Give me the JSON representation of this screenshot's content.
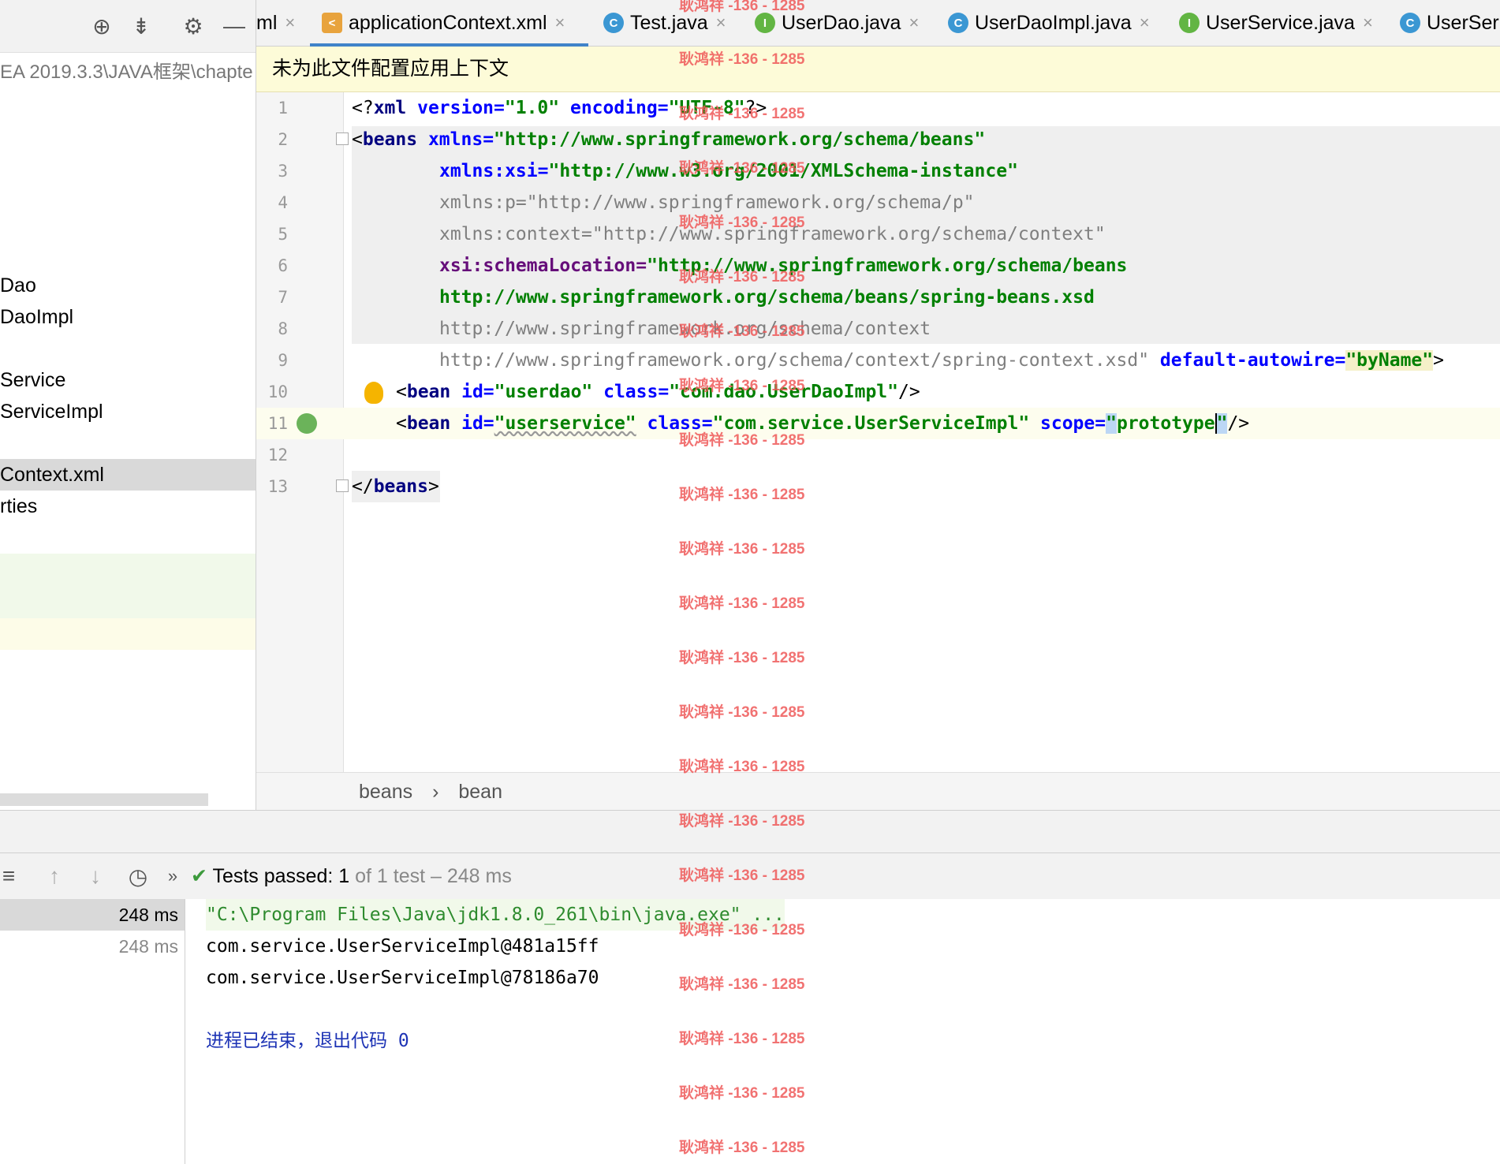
{
  "project_panel": {
    "path_text": "EA 2019.3.3\\JAVA框架\\chapte",
    "items": [
      {
        "label": "Dao"
      },
      {
        "label": "DaoImpl"
      },
      {
        "label": "Service"
      },
      {
        "label": "ServiceImpl"
      },
      {
        "label": "Context.xml"
      },
      {
        "label": "rties"
      }
    ]
  },
  "tabs": [
    {
      "label": "ml",
      "icon": "xml-file-icon"
    },
    {
      "label": "applicationContext.xml",
      "icon": "spring-xml-icon",
      "active": true
    },
    {
      "label": "Test.java",
      "icon": "class-icon",
      "icon_letter": "C"
    },
    {
      "label": "UserDao.java",
      "icon": "interface-icon",
      "icon_letter": "I"
    },
    {
      "label": "UserDaoImpl.java",
      "icon": "class-icon",
      "icon_letter": "C"
    },
    {
      "label": "UserService.java",
      "icon": "interface-icon",
      "icon_letter": "I"
    },
    {
      "label": "UserSer",
      "icon": "class-icon",
      "icon_letter": "C"
    }
  ],
  "banner": {
    "text": "未为此文件配置应用上下文"
  },
  "editor": {
    "line_numbers": [
      "1",
      "2",
      "3",
      "4",
      "5",
      "6",
      "7",
      "8",
      "9",
      "10",
      "11",
      "12",
      "13"
    ],
    "lines": {
      "l1": {
        "a": "<?",
        "b": "xml",
        "c": " version=",
        "d": "\"1.0\"",
        "e": " encoding=",
        "f": "\"UTF-8\"",
        "g": "?>"
      },
      "l2": {
        "a": "<",
        "b": "beans",
        "c": " xmlns=",
        "d": "\"http://www.springframework.org/schema/beans\""
      },
      "l3": {
        "a": "xmlns:xsi=",
        "b": "\"http://www.w3.org/2001/XMLSchema-instance\""
      },
      "l4": {
        "a": "xmlns:p=\"http://www.springframework.org/schema/p\""
      },
      "l5": {
        "a": "xmlns:context=\"http://www.springframework.org/schema/context\""
      },
      "l6": {
        "a": "xsi:schemaLocation=",
        "b": "\"http://www.springframework.org/schema/beans"
      },
      "l7": {
        "a": "http://www.springframework.org/schema/beans/spring-beans.xsd"
      },
      "l8": {
        "a": "http://www.springframework.org/schema/context"
      },
      "l9": {
        "a": "http://www.springframework.org/schema/context/spring-context.xsd\"",
        "b": " default-autowire=",
        "c": "\"byName\"",
        "d": ">"
      },
      "l10": {
        "a": "<",
        "b": "bean",
        "c": " id=",
        "d": "\"userdao\"",
        "e": " class=",
        "f": "\"com.dao.UserDaoImpl\"",
        "g": "/>"
      },
      "l11": {
        "a": "<",
        "b": "bean",
        "c": " id=",
        "d": "\"userservice\"",
        "e": " class=",
        "f": "\"com.service.UserServiceImpl\"",
        "g": " scope=",
        "h": "\"",
        "i": "prototype",
        "j": "\"",
        "k": "/>"
      },
      "l13": {
        "a": "</",
        "b": "beans",
        "c": ">"
      }
    }
  },
  "breadcrumb": {
    "items": [
      "beans",
      "bean"
    ],
    "separator": "›"
  },
  "run": {
    "status_prefix": "Tests passed:",
    "status_count": "1",
    "status_suffix": "of 1 test – 248 ms",
    "tree_times": [
      "248 ms",
      "248 ms"
    ],
    "console": [
      "\"C:\\Program Files\\Java\\jdk1.8.0_261\\bin\\java.exe\" ...",
      "com.service.UserServiceImpl@481a15ff",
      "com.service.UserServiceImpl@78186a70",
      "进程已结束，退出代码 0"
    ]
  },
  "watermark": {
    "text": "耿鸿祥 -136 - 1285"
  },
  "colors": {
    "tag": "#000080",
    "attr": "#0000ff",
    "string": "#008000",
    "accent": "#4083c9",
    "watermark": "#ef5a5a"
  }
}
